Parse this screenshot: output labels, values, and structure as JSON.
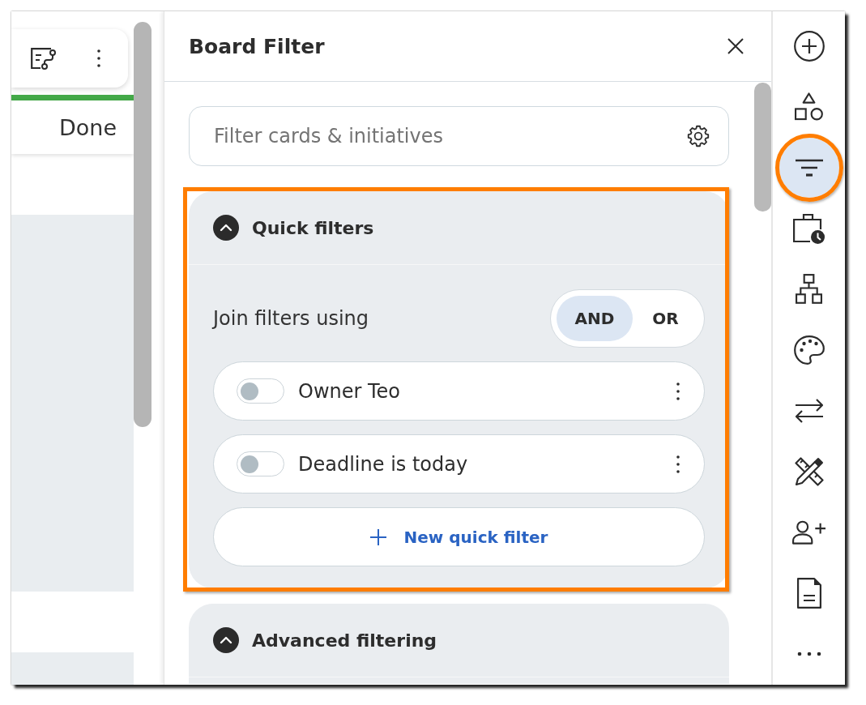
{
  "board": {
    "lane_title": "Done"
  },
  "panel": {
    "title": "Board Filter",
    "search": {
      "placeholder": "Filter cards & initiatives"
    },
    "sections": [
      {
        "title": "Quick filters",
        "expanded": true,
        "highlighted": true,
        "join": {
          "label": "Join filters using",
          "options": [
            {
              "label": "AND",
              "selected": true
            },
            {
              "label": "OR",
              "selected": false
            }
          ]
        },
        "filters": [
          {
            "label": "Owner Teo",
            "on": false
          },
          {
            "label": "Deadline is today",
            "on": false
          }
        ],
        "add_button": "New quick filter"
      },
      {
        "title": "Advanced filtering",
        "expanded": true,
        "highlighted": false
      }
    ]
  },
  "rail": {
    "items": [
      {
        "kind": "add",
        "selected": false,
        "highlighted": false
      },
      {
        "kind": "shapes",
        "selected": false,
        "highlighted": false
      },
      {
        "kind": "filter",
        "selected": true,
        "highlighted": true
      },
      {
        "kind": "timesheet",
        "selected": false,
        "highlighted": false
      },
      {
        "kind": "hierarchy",
        "selected": false,
        "highlighted": false
      },
      {
        "kind": "palette",
        "selected": false,
        "highlighted": false
      },
      {
        "kind": "swap",
        "selected": false,
        "highlighted": false
      },
      {
        "kind": "tools",
        "selected": false,
        "highlighted": false
      },
      {
        "kind": "invite",
        "selected": false,
        "highlighted": false
      },
      {
        "kind": "document",
        "selected": false,
        "highlighted": false
      },
      {
        "kind": "more",
        "selected": false,
        "highlighted": false
      }
    ]
  }
}
